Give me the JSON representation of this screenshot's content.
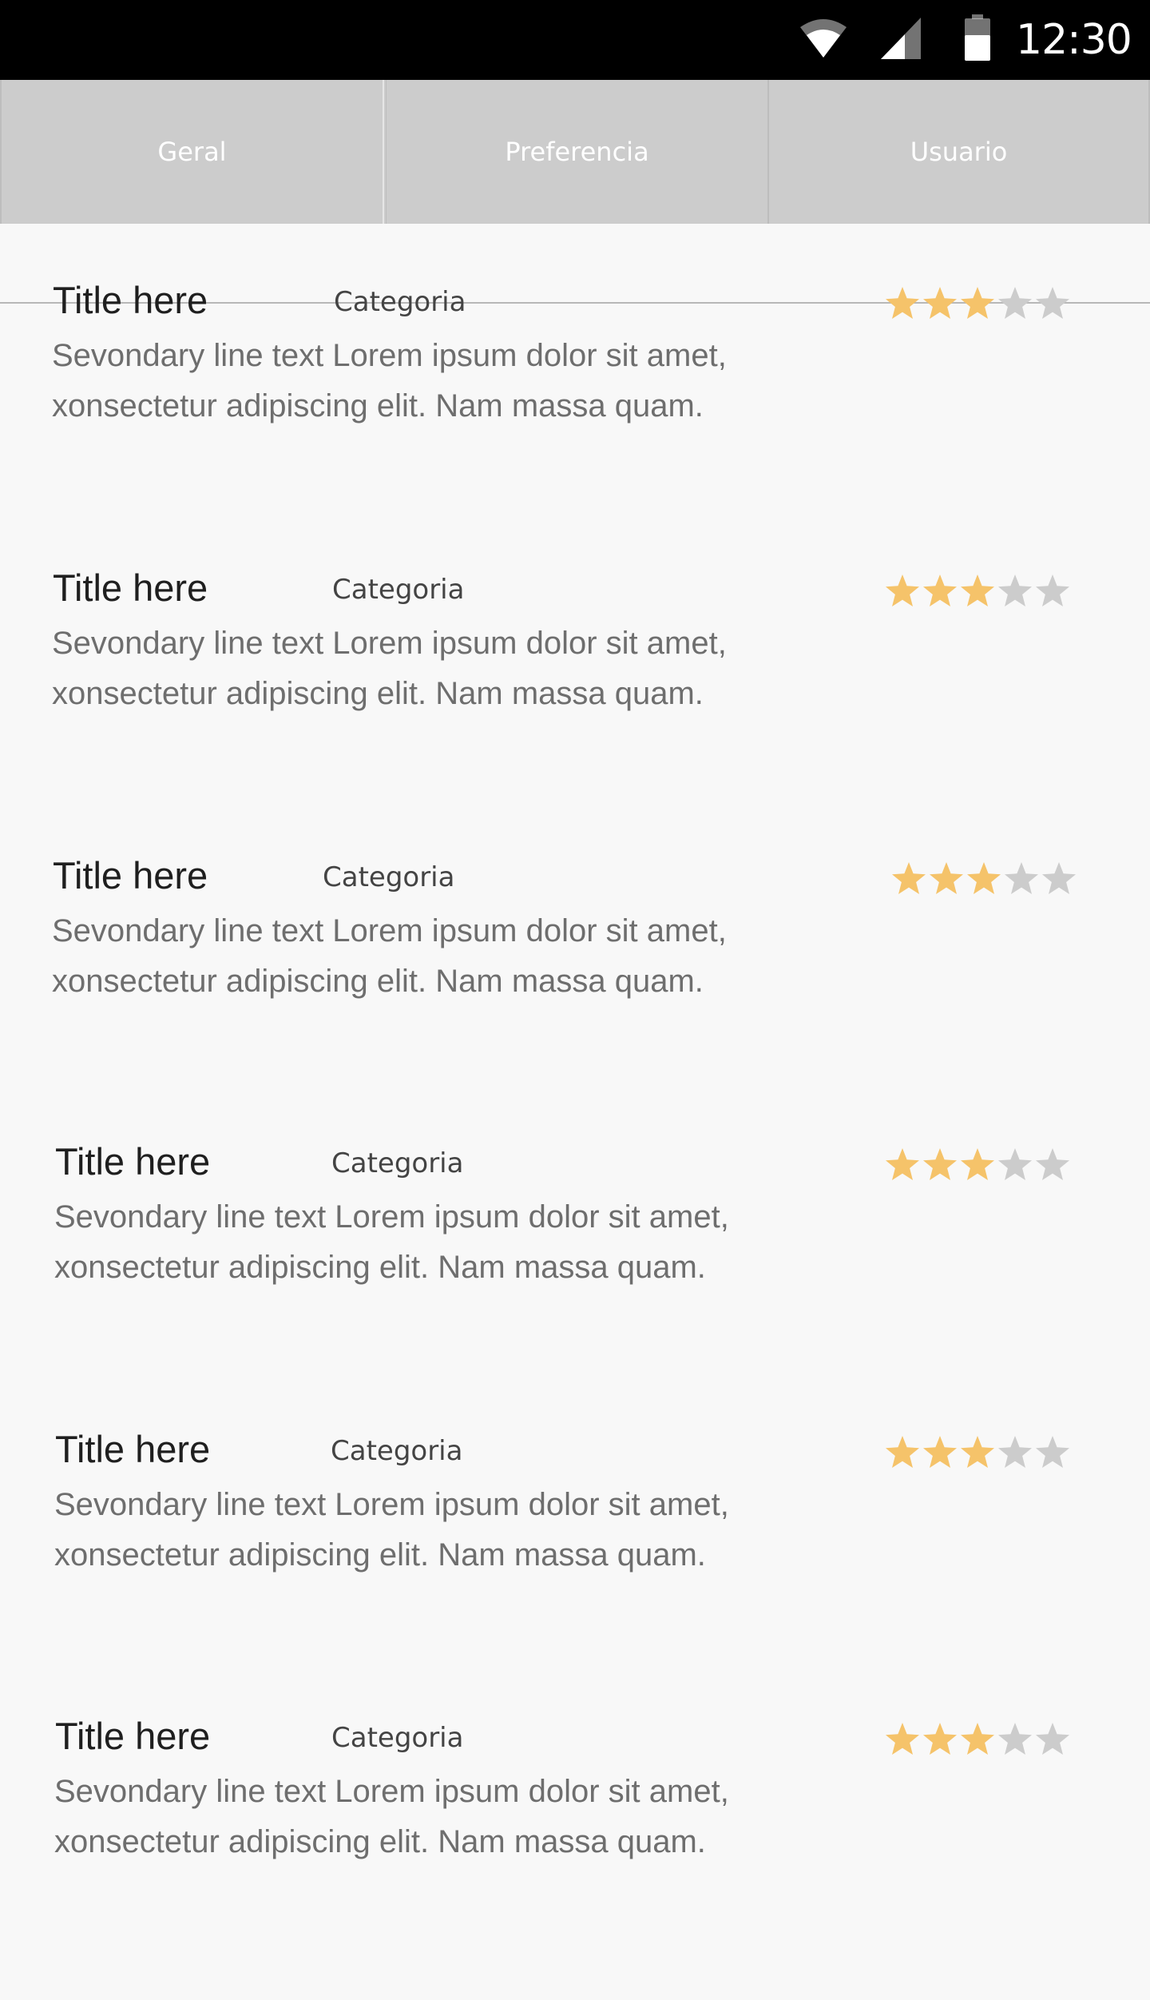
{
  "status_bar": {
    "time": "12:30",
    "icons": [
      "wifi-icon",
      "cellular-signal-icon",
      "battery-icon"
    ]
  },
  "tabs": [
    {
      "label": "Geral"
    },
    {
      "label": "Preferencia"
    },
    {
      "label": "Usuario"
    }
  ],
  "colors": {
    "star_filled": "#f5c36a",
    "star_empty": "#cccccc",
    "tab_background": "#cccccc",
    "status_bar": "#000000",
    "page_background": "#f8f8f8"
  },
  "list": {
    "items": [
      {
        "title": "Title here",
        "category": "Categoria",
        "line1": "Sevondary line text Lorem ipsum dolor sit amet,",
        "line2": "xonsectetur adipiscing elit. Nam massa quam.",
        "rating": 3,
        "max_rating": 5
      },
      {
        "title": "Title here",
        "category": "Categoria",
        "line1": "Sevondary line text Lorem ipsum dolor sit amet,",
        "line2": "xonsectetur adipiscing elit. Nam massa quam.",
        "rating": 3,
        "max_rating": 5
      },
      {
        "title": "Title here",
        "category": "Categoria",
        "line1": "Sevondary line text Lorem ipsum dolor sit amet,",
        "line2": "xonsectetur adipiscing elit. Nam massa quam.",
        "rating": 3,
        "max_rating": 5
      },
      {
        "title": "Title here",
        "category": "Categoria",
        "line1": "Sevondary line text Lorem ipsum dolor sit amet,",
        "line2": "xonsectetur adipiscing elit. Nam massa quam.",
        "rating": 3,
        "max_rating": 5
      },
      {
        "title": "Title here",
        "category": "Categoria",
        "line1": "Sevondary line text Lorem ipsum dolor sit amet,",
        "line2": "xonsectetur adipiscing elit. Nam massa quam.",
        "rating": 3,
        "max_rating": 5
      },
      {
        "title": "Title here",
        "category": "Categoria",
        "line1": "Sevondary line text Lorem ipsum dolor sit amet,",
        "line2": "xonsectetur adipiscing elit. Nam massa quam.",
        "rating": 3,
        "max_rating": 5
      }
    ]
  }
}
